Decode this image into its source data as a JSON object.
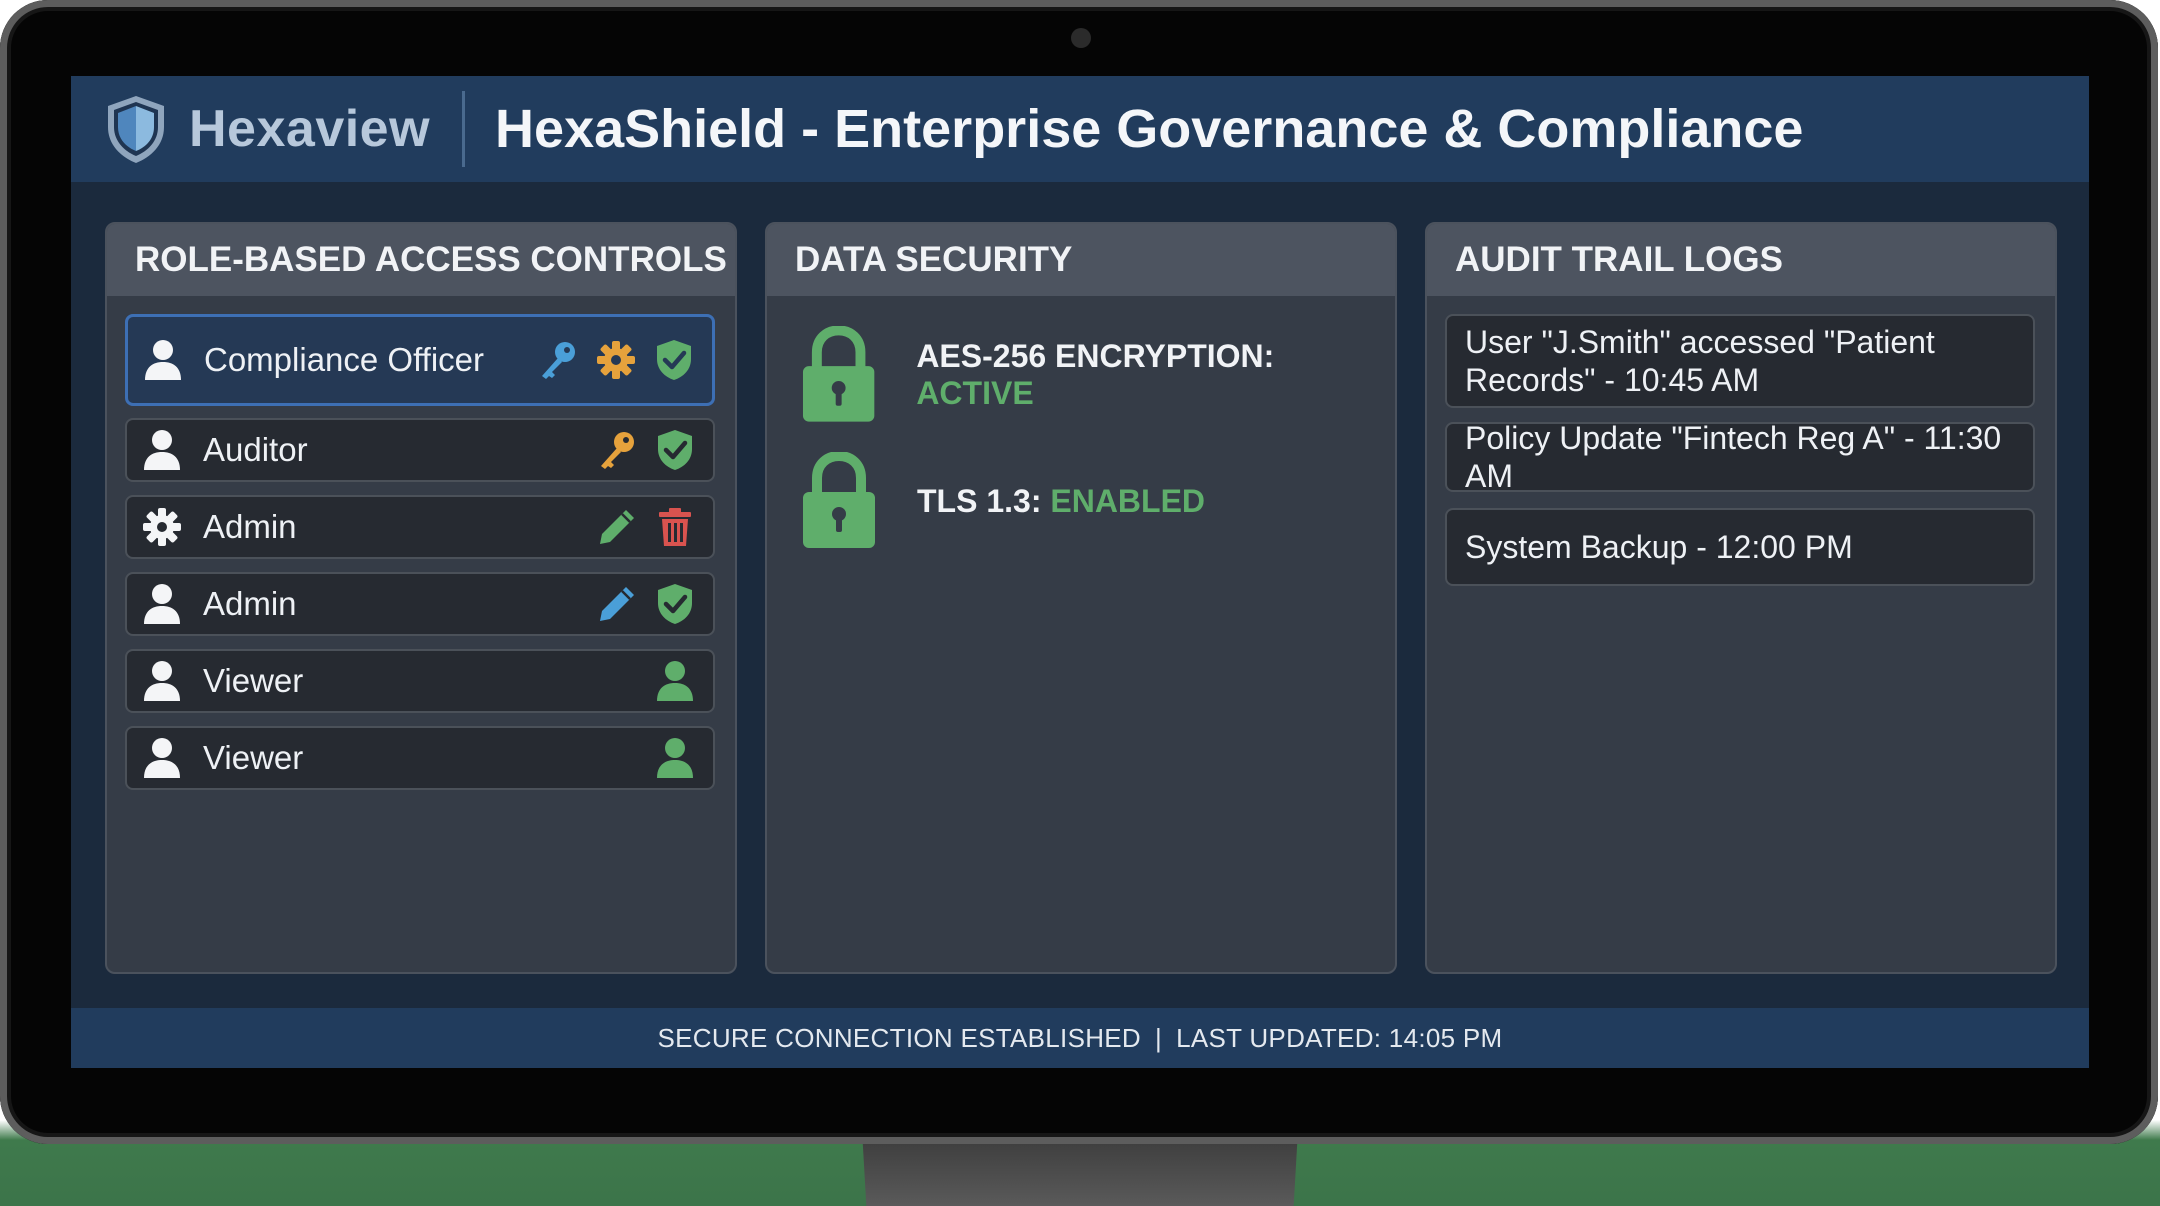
{
  "header": {
    "brand": "Hexaview",
    "title": "HexaShield - Enterprise Governance & Compliance"
  },
  "access_panel": {
    "title": "ROLE-BASED ACCESS CONTROLS",
    "roles": [
      {
        "label": "Compliance Officer",
        "icon": "user-icon",
        "actions": [
          "key-icon",
          "gear-icon",
          "shield-check-icon"
        ],
        "selected": true
      },
      {
        "label": "Auditor",
        "icon": "user-icon",
        "actions": [
          "key-icon",
          "shield-check-icon"
        ]
      },
      {
        "label": "Admin",
        "icon": "gear-icon",
        "actions": [
          "pencil-icon",
          "trash-icon"
        ]
      },
      {
        "label": "Admin",
        "icon": "user-icon",
        "actions": [
          "pencil-icon",
          "shield-check-icon"
        ]
      },
      {
        "label": "Viewer",
        "icon": "user-icon",
        "actions": [
          "user-icon"
        ]
      },
      {
        "label": "Viewer",
        "icon": "user-icon",
        "actions": [
          "user-icon"
        ]
      }
    ]
  },
  "security_panel": {
    "title": "DATA SECURITY",
    "items": [
      {
        "label": "AES-256 ENCRYPTION:",
        "status": "ACTIVE",
        "icon": "lock-icon"
      },
      {
        "label": "TLS 1.3:",
        "status": "ENABLED",
        "icon": "lock-icon"
      }
    ]
  },
  "audit_panel": {
    "title": "AUDIT TRAIL LOGS",
    "logs": [
      "User \"J.Smith\" accessed \"Patient Records\" - 10:45 AM",
      "Policy Update \"Fintech Reg A\" - 11:30 AM",
      "System Backup - 12:00 PM"
    ]
  },
  "status_bar": {
    "connection": "SECURE CONNECTION ESTABLISHED",
    "separator": "|",
    "updated": "LAST UPDATED: 14:05 PM"
  },
  "colors": {
    "header": "#213c5d",
    "panel": "#353c47",
    "panel_header": "#4d5460",
    "status_green": "#5fae6b",
    "key_blue": "#4a9fd8",
    "key_orange": "#e6a23c",
    "trash_red": "#d9534f",
    "selected_border": "#3d6fb4"
  }
}
